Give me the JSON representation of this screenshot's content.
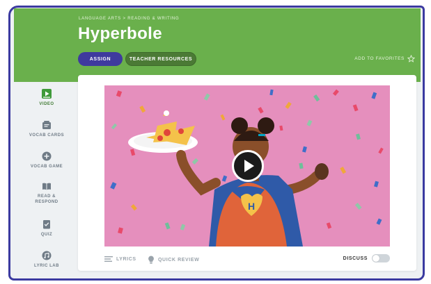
{
  "header": {
    "breadcrumb": "LANGUAGE ARTS  >  READING & WRITING",
    "title": "Hyperbole",
    "assign_label": "ASSIGN",
    "teacher_resources_label": "TEACHER RESOURCES",
    "favorites_label": "ADD TO FAVORITES"
  },
  "sidebar": {
    "items": [
      {
        "label": "VIDEO",
        "icon": "video-icon",
        "active": true
      },
      {
        "label": "VOCAB CARDS",
        "icon": "vocab-cards-icon",
        "active": false
      },
      {
        "label": "VOCAB GAME",
        "icon": "vocab-game-icon",
        "active": false
      },
      {
        "label": "READ & RESPOND",
        "icon": "book-icon",
        "active": false
      },
      {
        "label": "QUIZ",
        "icon": "quiz-icon",
        "active": false
      },
      {
        "label": "LYRIC LAB",
        "icon": "lyric-lab-icon",
        "active": false
      }
    ]
  },
  "player": {
    "lyrics_label": "LYRICS",
    "quick_review_label": "QUICK REVIEW",
    "discuss_label": "DISCUSS",
    "badge_letter": "H"
  },
  "colors": {
    "header_green": "#6ab04c",
    "brand_purple": "#3f3a9e",
    "video_pink": "#e58fbd"
  }
}
